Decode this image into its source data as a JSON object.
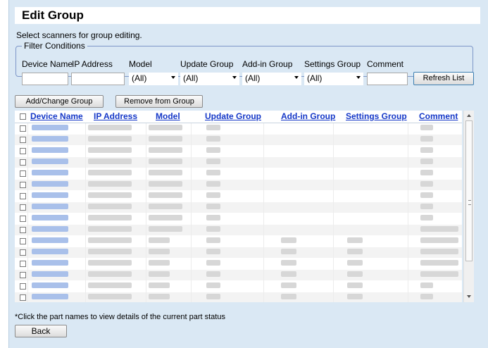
{
  "title": "Edit Group",
  "subtitle": "Select scanners for group editing.",
  "filter": {
    "legend": "Filter Conditions",
    "labels": {
      "device_name": "Device Name",
      "ip_address": "IP Address",
      "model": "Model",
      "update_group": "Update Group",
      "addin_group": "Add-in Group",
      "settings_group": "Settings Group",
      "comment": "Comment"
    },
    "values": {
      "device_name": "",
      "ip_address": "",
      "model": "(All)",
      "update_group": "(All)",
      "addin_group": "(All)",
      "settings_group": "(All)",
      "comment": ""
    },
    "refresh_label": "Refresh List"
  },
  "actions": {
    "add_change_label": "Add/Change Group",
    "remove_label": "Remove from Group"
  },
  "table": {
    "columns": [
      "Device Name",
      "IP Address",
      "Model",
      "Update Group",
      "Add-in Group",
      "Settings Group",
      "Comment"
    ],
    "row_count": 16
  },
  "note": "*Click the part names to view details of the current part status",
  "back_label": "Back"
}
